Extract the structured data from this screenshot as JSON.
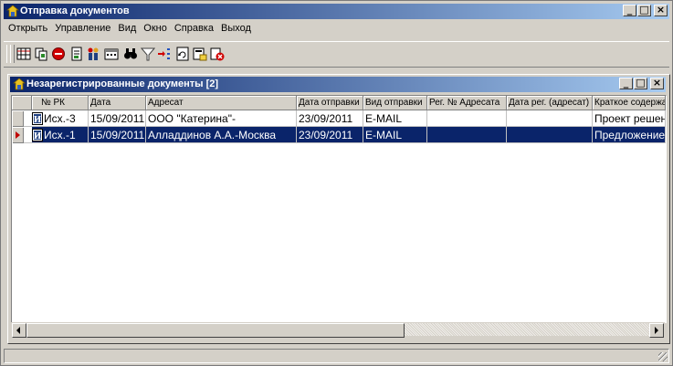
{
  "window": {
    "title": "Отправка документов",
    "icon": "app-icon"
  },
  "menu": [
    "Открыть",
    "Управление",
    "Вид",
    "Окно",
    "Справка",
    "Выход"
  ],
  "toolbar": {
    "icons": [
      "table-icon",
      "copy-icon",
      "stop-icon",
      "document-icon",
      "people-icon",
      "calendar-icon",
      "binoculars-icon",
      "filter-icon",
      "sort-icon",
      "refresh-icon",
      "export-icon",
      "delete-icon"
    ]
  },
  "child_window": {
    "title": "Незарегистрированные документы [2]",
    "columns": [
      "№ РК",
      "Дата",
      "Адресат",
      "Дата отправки",
      "Вид отправки",
      "Рег. № Адресата",
      "Дата рег. (адресат)",
      "Краткое содержание"
    ],
    "rows": [
      {
        "rk": "Исх.-3",
        "date": "15/09/2011",
        "addressee": "ООО \"Катерина\"-",
        "sent": "23/09/2011",
        "method": "E-MAIL",
        "regno": "",
        "regdate": "",
        "summary": "Проект решения",
        "selected": false
      },
      {
        "rk": "Исх.-1",
        "date": "15/09/2011",
        "addressee": "Алладдинов А.А.-Москва",
        "sent": "23/09/2011",
        "method": "E-MAIL",
        "regno": "",
        "regdate": "",
        "summary": "Предложение",
        "selected": true
      }
    ]
  },
  "colors": {
    "titlebar": "#0a246a",
    "selection": "#0a246a",
    "face": "#d4d0c8"
  }
}
